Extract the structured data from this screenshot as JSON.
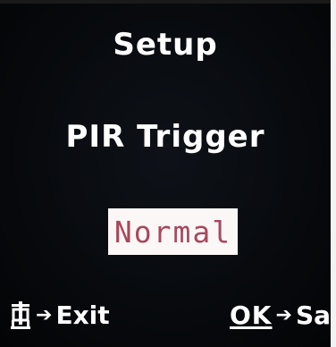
{
  "screen": {
    "title": "Setup",
    "setting_name": "PIR Trigger",
    "selected_value": "Normal"
  },
  "footer": {
    "left_key_icon": "gear-icon",
    "arrow_glyph": "➔",
    "left_action": "Exit",
    "right_key": "OK",
    "right_action": "Save"
  },
  "colors": {
    "background": "#06080b",
    "text": "#ffffff",
    "option_box": "#fbf7f7",
    "option_text": "#a8485c"
  }
}
